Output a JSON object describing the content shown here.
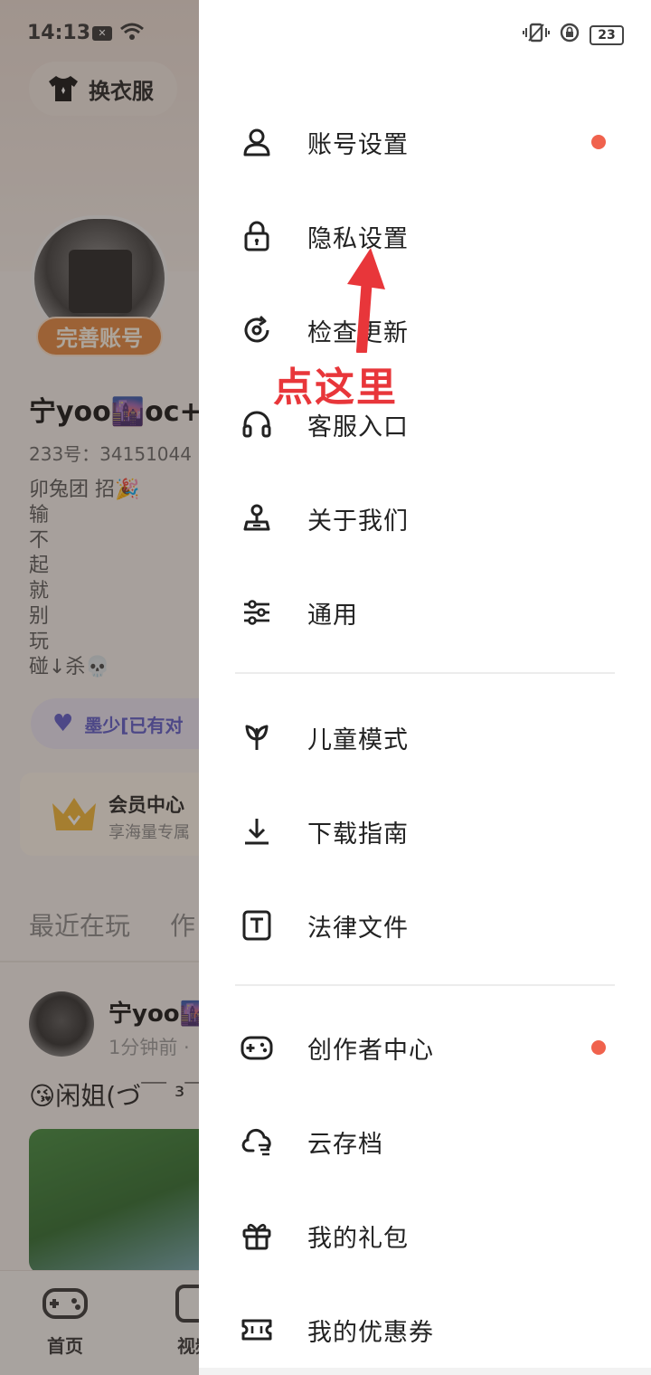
{
  "status_bar": {
    "time": "14:13",
    "battery": "23",
    "icons": [
      "x-notification-icon",
      "wifi-icon",
      "vibrate-icon",
      "rotation-lock-icon",
      "battery-icon"
    ]
  },
  "background": {
    "outfit_button": "换衣服",
    "complete_account": "完善账号",
    "username": "宁yoo🌆oc+_",
    "user_id": "233号：34151044",
    "bio": "卯兔团 招🎉\n输\n不\n起\n就\n别\n玩\n碰↓杀💀",
    "couple_pill": "墨少[已有对",
    "vip": {
      "title": "会员中心",
      "subtitle": "享海量专属"
    },
    "tabs": [
      "最近在玩",
      "作"
    ],
    "post": {
      "username": "宁yoo🌆",
      "time": "1分钟前 ·",
      "text": "😘闲姐(づ￣ ³￣"
    },
    "bottom_nav": [
      "首页",
      "视频"
    ]
  },
  "drawer": {
    "accent": "#f0624d",
    "groups": [
      [
        {
          "label": "账号设置",
          "icon": "user-icon",
          "dot": true
        },
        {
          "label": "隐私设置",
          "icon": "lock-icon",
          "dot": false
        },
        {
          "label": "检查更新",
          "icon": "refresh-icon",
          "dot": false
        },
        {
          "label": "客服入口",
          "icon": "headset-icon",
          "dot": false
        },
        {
          "label": "关于我们",
          "icon": "stamp-icon",
          "dot": false
        },
        {
          "label": "通用",
          "icon": "sliders-icon",
          "dot": false
        }
      ],
      [
        {
          "label": "儿童模式",
          "icon": "sprout-icon",
          "dot": false
        },
        {
          "label": "下载指南",
          "icon": "download-icon",
          "dot": false
        },
        {
          "label": "法律文件",
          "icon": "text-doc-icon",
          "dot": false
        }
      ],
      [
        {
          "label": "创作者中心",
          "icon": "gamepad-icon",
          "dot": true
        },
        {
          "label": "云存档",
          "icon": "cloud-icon",
          "dot": false
        },
        {
          "label": "我的礼包",
          "icon": "gift-icon",
          "dot": false
        },
        {
          "label": "我的优惠券",
          "icon": "ticket-icon",
          "dot": false
        }
      ]
    ]
  },
  "annotation": {
    "text": "点这里",
    "color": "#e8363a"
  }
}
